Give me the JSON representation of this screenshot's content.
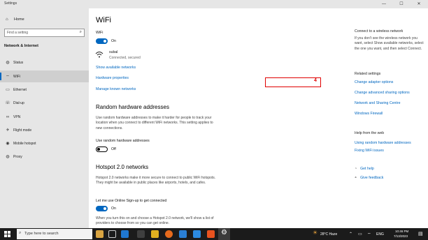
{
  "window": {
    "title": "Settings",
    "minimize": "—",
    "maximize": "☐",
    "close": "✕"
  },
  "sidebar": {
    "home": "Home",
    "search_placeholder": "Find a setting",
    "category": "Network & Internet",
    "items": [
      {
        "label": "Status",
        "icon": "globe-icon"
      },
      {
        "label": "WiFi",
        "icon": "wifi-icon"
      },
      {
        "label": "Ethernet",
        "icon": "ethernet-icon"
      },
      {
        "label": "Dial-up",
        "icon": "phone-icon"
      },
      {
        "label": "VPN",
        "icon": "vpn-icon"
      },
      {
        "label": "Flight mode",
        "icon": "airplane-icon"
      },
      {
        "label": "Mobile hotspot",
        "icon": "hotspot-icon"
      },
      {
        "label": "Proxy",
        "icon": "globe-icon"
      }
    ]
  },
  "main": {
    "title": "WiFi",
    "wifi_label": "WiFi",
    "wifi_state": "On",
    "network_name": "subal",
    "network_status": "Connected, secured",
    "link_show_networks": "Show available networks",
    "link_hardware": "Hardware properties",
    "link_manage": "Manage known networks",
    "random_heading": "Random hardware addresses",
    "random_para": "Use random hardware addresses to make it harder for people to track your location when you connect to different WiFi networks. This setting applies to new connections.",
    "random_toggle_label": "Use random hardware addresses",
    "random_state": "Off",
    "hotspot_heading": "Hotspot 2.0 networks",
    "hotspot_para": "Hotspot 2.0 networks make it more secure to connect to public WiFi hotspots. They might be available in public places like airports, hotels, and cafes.",
    "online_label": "Let me use Online Sign-up to get connected",
    "online_state": "On",
    "online_para": "When you turn this on and choose a Hotspot 2.0 network, we'll show a list of providers to choose from so you can get online."
  },
  "right": {
    "connect_title": "Connect to a wireless network",
    "connect_para": "If you don't see the wireless network you want, select Show available networks, select the one you want, and then select Connect.",
    "related_title": "Related settings",
    "links": [
      "Change adapter options",
      "Change advanced sharing options",
      "Network and Sharing Centre",
      "Windows Firewall"
    ],
    "annotation": "4",
    "help_title": "Help from the web",
    "help_links": [
      "Using random hardware addresses",
      "Fixing WiFi issues"
    ],
    "get_help": "Get help",
    "feedback": "Give feedback"
  },
  "taskbar": {
    "search_placeholder": "Type here to search",
    "weather": "28°C  Haze",
    "language": "ENG",
    "time": "10:46 PM",
    "date": "7/13/2023"
  },
  "colors": {
    "accent": "#0067c0",
    "highlight": "#e00000",
    "sidebar_bg": "#e6e6e6",
    "taskbar_bg": "#1b1b1b"
  }
}
